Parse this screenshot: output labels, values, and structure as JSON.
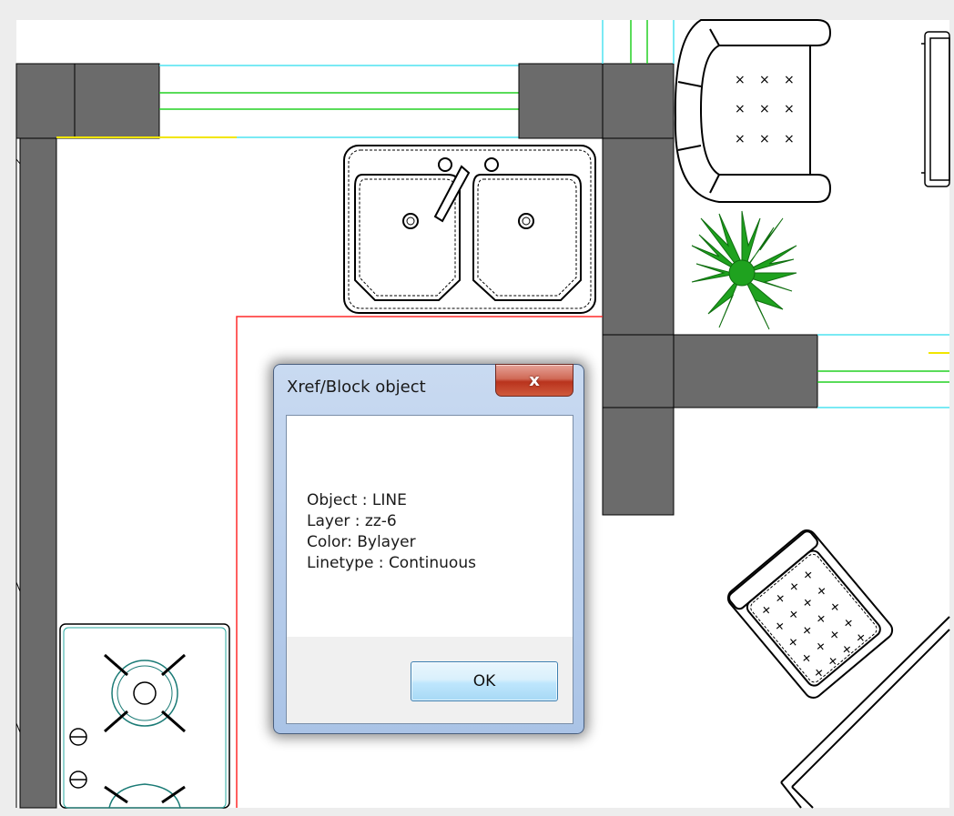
{
  "dialog": {
    "title": "Xref/Block object",
    "close_glyph": "x",
    "object_line": "Object : LINE",
    "layer_line": "Layer : zz-6",
    "color_line": "Color: Bylayer",
    "linetype_line": "Linetype : Continuous",
    "ok_label": "OK"
  },
  "drawing": {
    "wall_color": "#6b6b6b",
    "cyan_line": "#4fe3f0",
    "green_line": "#22d122",
    "yellow_line": "#f2e600",
    "red_line": "#ff2a2a",
    "plant_color": "#1fa21f",
    "canvas_bg": "#ffffff"
  }
}
